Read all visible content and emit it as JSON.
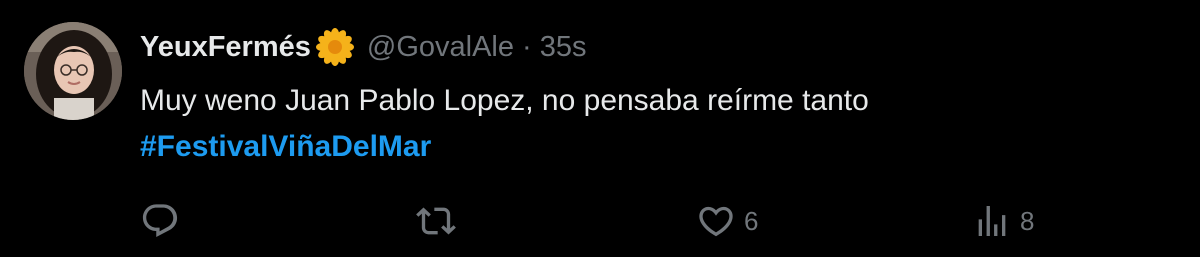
{
  "author": {
    "display_name": "YeuxFermés",
    "badge_icon": "flower-icon",
    "handle": "@GovalAle",
    "separator": "·",
    "timestamp": "35s"
  },
  "tweet": {
    "text": "Muy weno Juan Pablo Lopez, no pensaba reírme tanto",
    "hashtag": "#FestivalViñaDelMar"
  },
  "actions": {
    "reply": {
      "icon": "reply-icon",
      "count": ""
    },
    "retweet": {
      "icon": "retweet-icon",
      "count": ""
    },
    "like": {
      "icon": "heart-icon",
      "count": "6"
    },
    "views": {
      "icon": "views-icon",
      "count": "8"
    }
  },
  "colors": {
    "background": "#000000",
    "text": "#e7e9ea",
    "muted": "#71767b",
    "accent": "#1d9bf0",
    "badge": "#f5b21a"
  }
}
